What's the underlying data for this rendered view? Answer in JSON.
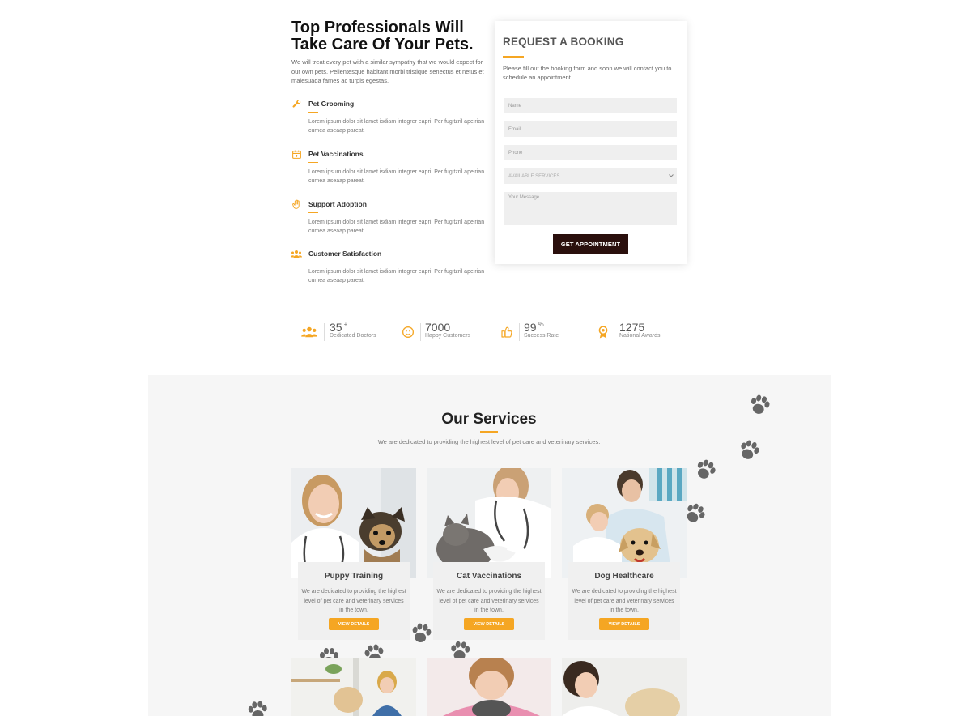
{
  "hero": {
    "title": "Top Professionals Will Take Care Of Your Pets.",
    "description": "We will treat every pet with a similar sympathy that we would expect for our own pets. Pellentesque habitant morbi tristique senectus et netus et malesuada fames ac turpis egestas."
  },
  "features": [
    {
      "title": "Pet Grooming",
      "icon": "wrench-icon",
      "desc": "Lorem ipsum dolor sit lamet isdiam integrer eapri. Per fugitzril apeirian cumea aseaap pareat."
    },
    {
      "title": "Pet Vaccinations",
      "icon": "calendar-plus-icon",
      "desc": "Lorem ipsum dolor sit lamet isdiam integrer eapri. Per fugitzril apeirian cumea aseaap pareat."
    },
    {
      "title": "Support Adoption",
      "icon": "hand-icon",
      "desc": "Lorem ipsum dolor sit lamet isdiam integrer eapri. Per fugitzril apeirian cumea aseaap pareat."
    },
    {
      "title": "Customer Satisfaction",
      "icon": "users-icon",
      "desc": "Lorem ipsum dolor sit lamet isdiam integrer eapri. Per fugitzril apeirian cumea aseaap pareat."
    }
  ],
  "booking": {
    "title": "REQUEST A BOOKING",
    "description": "Please fill out the booking form and soon we will contact you to schedule an appointment.",
    "name_placeholder": "Name",
    "email_placeholder": "Email",
    "phone_placeholder": "Phone",
    "service_select": "AVAILABLE SERVICES",
    "message_placeholder": "Your Message...",
    "submit_label": "GET APPOINTMENT"
  },
  "stats": [
    {
      "number": "35",
      "suffix": "+",
      "label": "Dedicated Doctors",
      "icon": "users-icon"
    },
    {
      "number": "7000",
      "suffix": "",
      "label": "Happy Customers",
      "icon": "smile-icon"
    },
    {
      "number": "99",
      "suffix": "%",
      "label": "Success Rate",
      "icon": "thumbs-up-icon"
    },
    {
      "number": "1275",
      "suffix": "",
      "label": "National Awards",
      "icon": "award-icon"
    }
  ],
  "services": {
    "title": "Our Services",
    "subtitle": "We are dedicated to providing the highest level of pet care and veterinary services.",
    "cards": [
      {
        "title": "Puppy Training",
        "desc": "We are dedicated to providing the highest level of pet care and veterinary services in the town.",
        "button": "VIEW DETAILS"
      },
      {
        "title": "Cat Vaccinations",
        "desc": "We are dedicated to providing the highest level of pet care and veterinary services in the town.",
        "button": "VIEW DETAILS"
      },
      {
        "title": "Dog Healthcare",
        "desc": "We are dedicated to providing the highest level of pet care and veterinary services in the town.",
        "button": "VIEW DETAILS"
      }
    ]
  },
  "colors": {
    "accent": "#f5a623",
    "button_dark": "#2a0f0d",
    "section_bg": "#f6f6f6"
  }
}
